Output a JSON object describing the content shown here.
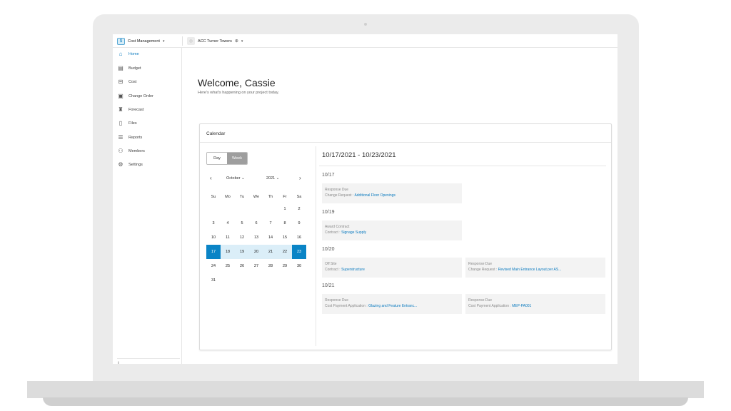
{
  "topbar": {
    "module_label": "Cost Management",
    "project_label": "ACC Turner Towers"
  },
  "sidebar": {
    "items": [
      {
        "label": "Home",
        "icon": "home-icon",
        "active": true
      },
      {
        "label": "Budget",
        "icon": "budget-icon"
      },
      {
        "label": "Cost",
        "icon": "cost-icon"
      },
      {
        "label": "Change Order",
        "icon": "change-order-icon"
      },
      {
        "label": "Forecast",
        "icon": "forecast-icon"
      },
      {
        "label": "Files",
        "icon": "file-icon"
      },
      {
        "label": "Reports",
        "icon": "reports-icon"
      },
      {
        "label": "Members",
        "icon": "members-icon"
      },
      {
        "label": "Settings",
        "icon": "gear-icon"
      }
    ]
  },
  "main": {
    "welcome": "Welcome, Cassie",
    "subtitle": "Here's what's happening on your project today."
  },
  "calendar": {
    "title": "Calendar",
    "view_day": "Day",
    "view_week": "Week",
    "month": "October",
    "year": "2021",
    "weekdays": [
      "Su",
      "Mo",
      "Tu",
      "We",
      "Th",
      "Fr",
      "Sa"
    ],
    "weeks": [
      [
        "",
        "",
        "",
        "",
        "",
        "1",
        "2"
      ],
      [
        "3",
        "4",
        "5",
        "6",
        "7",
        "8",
        "9"
      ],
      [
        "10",
        "11",
        "12",
        "13",
        "14",
        "15",
        "16"
      ],
      [
        "17",
        "18",
        "19",
        "20",
        "21",
        "22",
        "23"
      ],
      [
        "24",
        "25",
        "26",
        "27",
        "28",
        "29",
        "30"
      ],
      [
        "31",
        "",
        "",
        "",
        "",
        "",
        ""
      ]
    ],
    "range_title": "10/17/2021 - 10/23/2021",
    "days": [
      {
        "date": "10/17",
        "events": [
          {
            "kind": "Response Due",
            "type": "Change Request :",
            "link": "Additional Floor Openings"
          }
        ]
      },
      {
        "date": "10/19",
        "events": [
          {
            "kind": "Award Contract",
            "type": "Contract :",
            "link": "Signage Supply"
          }
        ]
      },
      {
        "date": "10/20",
        "events": [
          {
            "kind": "Off Site",
            "type": "Contract :",
            "link": "Superstructure"
          },
          {
            "kind": "Response Due",
            "type": "Change Request :",
            "link": "Revised Main Entrance Layout per AS..."
          }
        ]
      },
      {
        "date": "10/21",
        "events": [
          {
            "kind": "Response Due",
            "type": "Cost Payment Application :",
            "link": "Glazing and Feature Entranc..."
          },
          {
            "kind": "Response Due",
            "type": "Cost Payment Application :",
            "link": "MEP-PA001"
          }
        ]
      }
    ]
  },
  "colors": {
    "accent": "#0a7abf",
    "selected_day": "#0a84c6",
    "range_fill": "#dbeef8"
  }
}
